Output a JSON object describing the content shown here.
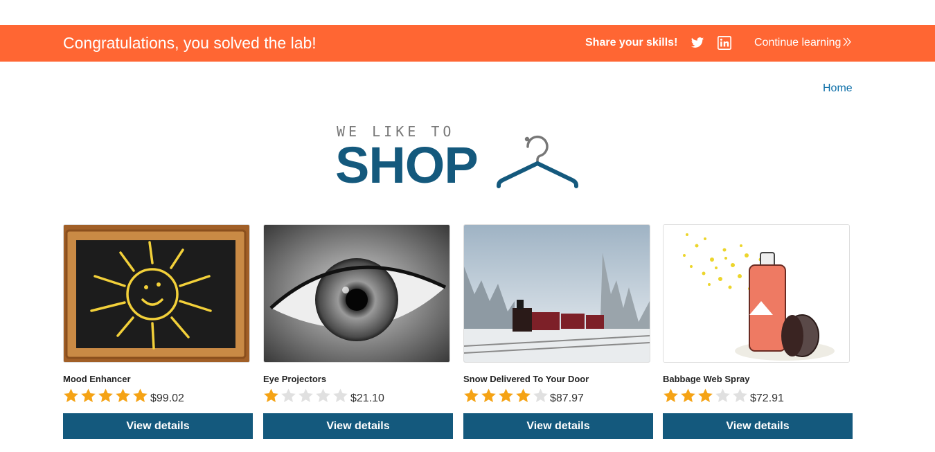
{
  "banner": {
    "title": "Congratulations, you solved the lab!",
    "share_label": "Share your skills!",
    "twitter_icon": "twitter-icon",
    "linkedin_icon": "linkedin-icon",
    "continue_label": "Continue learning",
    "color": "#ff6633"
  },
  "nav": {
    "home_label": "Home",
    "link_color": "#0b6ea8"
  },
  "logo": {
    "small_text": "WE LIKE TO",
    "big_text": "SHOP",
    "icon": "hanger-icon",
    "color": "#14597d"
  },
  "products": [
    {
      "name": "Mood Enhancer",
      "rating": 5,
      "price": "$99.02",
      "button_label": "View details",
      "image": "chalkboard-sun-image"
    },
    {
      "name": "Eye Projectors",
      "rating": 1,
      "price": "$21.10",
      "button_label": "View details",
      "image": "eye-closeup-image"
    },
    {
      "name": "Snow Delivered To Your Door",
      "rating": 4,
      "price": "$87.97",
      "button_label": "View details",
      "image": "snowy-train-image"
    },
    {
      "name": "Babbage Web Spray",
      "rating": 3,
      "price": "$72.91",
      "button_label": "View details",
      "image": "spray-can-image"
    }
  ],
  "colors": {
    "star_filled": "#f5a315",
    "star_empty": "#e0e0e0",
    "button": "#14597d"
  }
}
